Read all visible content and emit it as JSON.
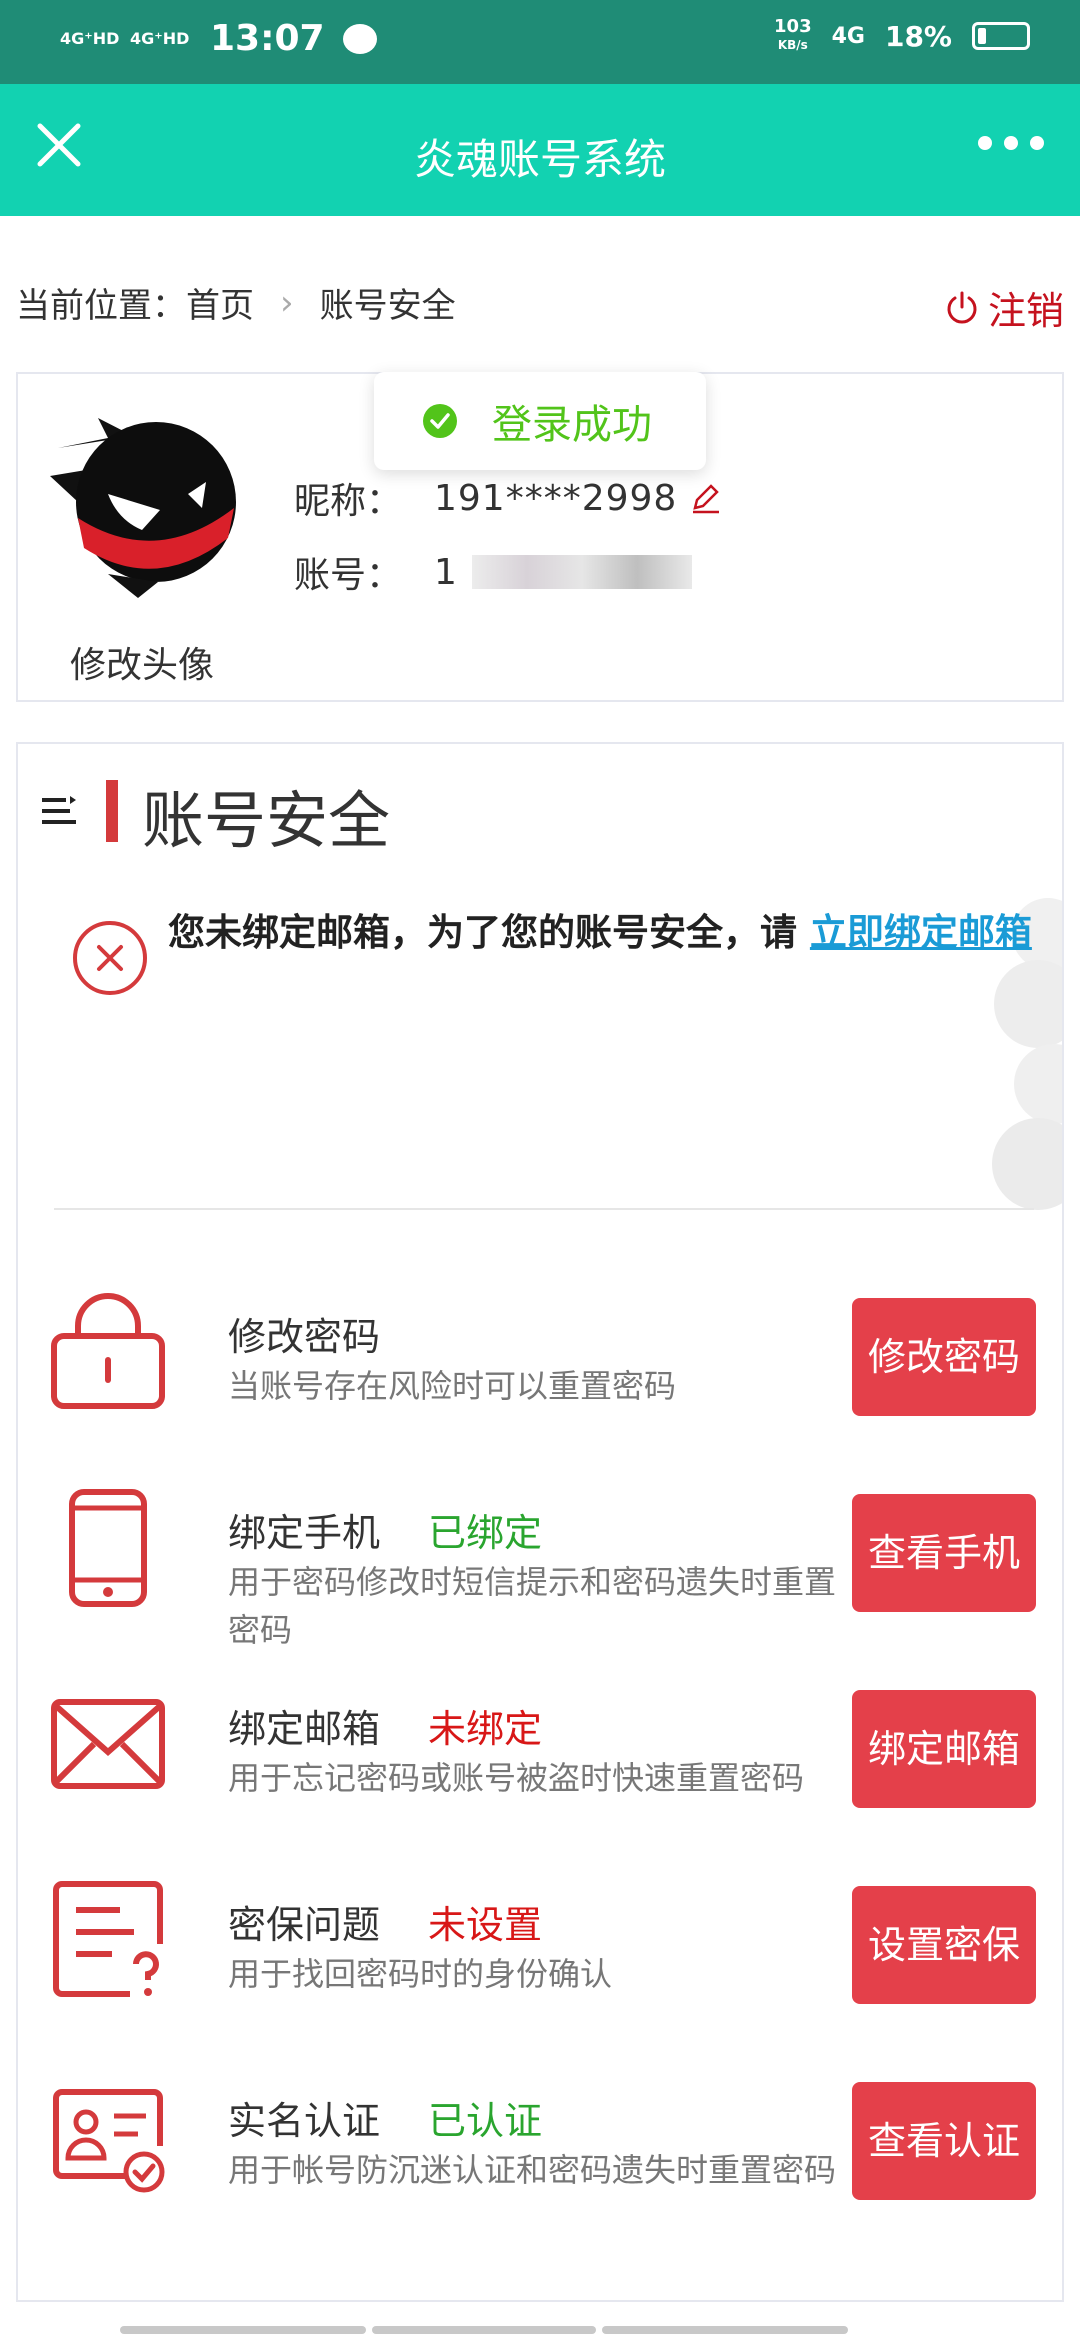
{
  "status_bar": {
    "signal1": "4G⁺HD",
    "signal2": "4G⁺HD",
    "time": "13:07",
    "speed": "103",
    "speed_unit": "KB/s",
    "network": "4G",
    "battery": "18%"
  },
  "header": {
    "title": "炎魂账号系统"
  },
  "breadcrumb": {
    "prefix": "当前位置：",
    "home": "首页",
    "separator": "›",
    "current": "账号安全"
  },
  "logout_label": "注销",
  "toast": {
    "message": "登录成功"
  },
  "profile": {
    "change_avatar": "修改头像",
    "nickname_label": "昵称：",
    "nickname_value": "191****2998",
    "account_label": "账号：",
    "account_value": "1"
  },
  "security": {
    "title": "账号安全",
    "warning_text": "您未绑定邮箱，为了您的账号安全，请 ",
    "warning_link": "立即绑定邮箱",
    "items": [
      {
        "name": "修改密码",
        "status": "",
        "desc": "当账号存在风险时可以重置密码",
        "button": "修改密码",
        "icon": "lock-icon"
      },
      {
        "name": "绑定手机",
        "status": "已绑定",
        "desc": "用于密码修改时短信提示和密码遗失时重置密码",
        "button": "查看手机",
        "icon": "phone-icon"
      },
      {
        "name": "绑定邮箱",
        "status": "未绑定",
        "desc": "用于忘记密码或账号被盗时快速重置密码",
        "button": "绑定邮箱",
        "icon": "mail-icon"
      },
      {
        "name": "密保问题",
        "status": "未设置",
        "desc": "用于找回密码时的身份确认",
        "button": "设置密保",
        "icon": "question-doc-icon"
      },
      {
        "name": "实名认证",
        "status": "已认证",
        "desc": "用于帐号防沉迷认证和密码遗失时重置密码",
        "button": "查看认证",
        "icon": "id-card-icon"
      }
    ]
  },
  "colors": {
    "title_bar": "#12d2b1",
    "status_bar": "#1f8c76",
    "accent_red": "#e4404a",
    "success_green": "#52c41a",
    "link_blue": "#1a9bd6"
  }
}
